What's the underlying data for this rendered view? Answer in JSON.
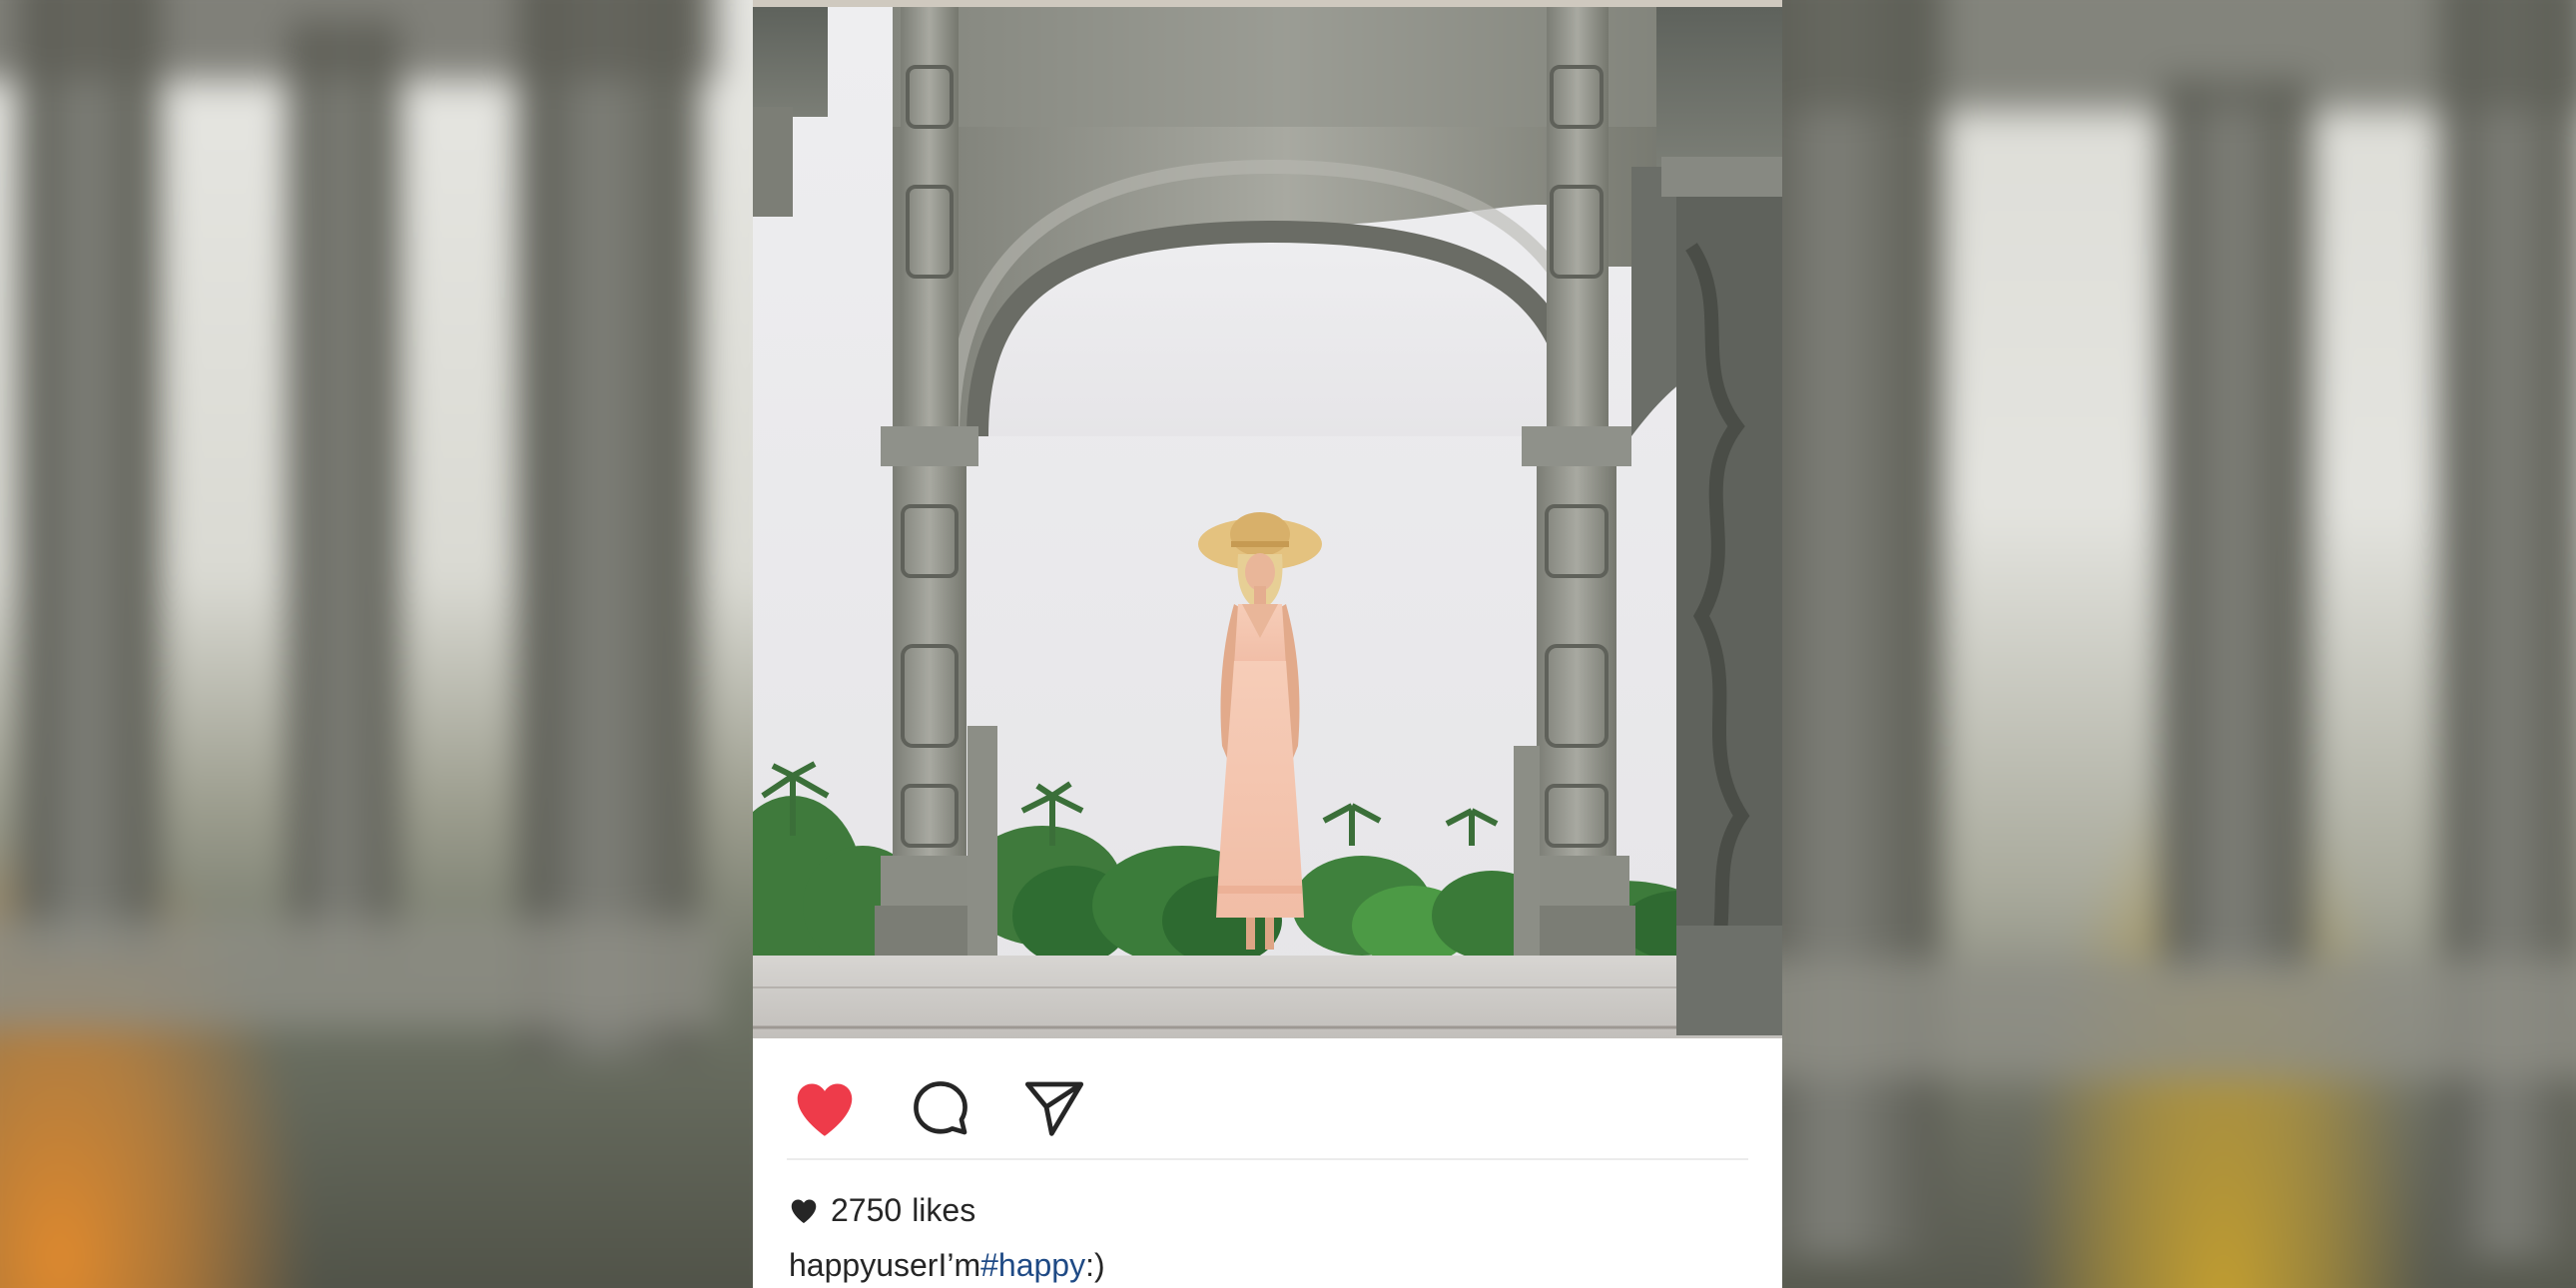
{
  "post": {
    "likes_count": "2750",
    "likes_label": "likes",
    "username": "happyuser",
    "caption_text": "I’m",
    "hashtag": "#happy",
    "caption_suffix": ":)"
  },
  "actions": {
    "like": {
      "icon": "heart-icon",
      "state": "liked",
      "color": "#ee3b4a"
    },
    "comment": {
      "icon": "comment-bubble-icon"
    },
    "share": {
      "icon": "paper-plane-icon"
    }
  },
  "colors": {
    "text": "#262626",
    "hashtag": "#1f4a85",
    "liked_heart": "#ee3b4a",
    "icon_stroke": "#262626"
  }
}
